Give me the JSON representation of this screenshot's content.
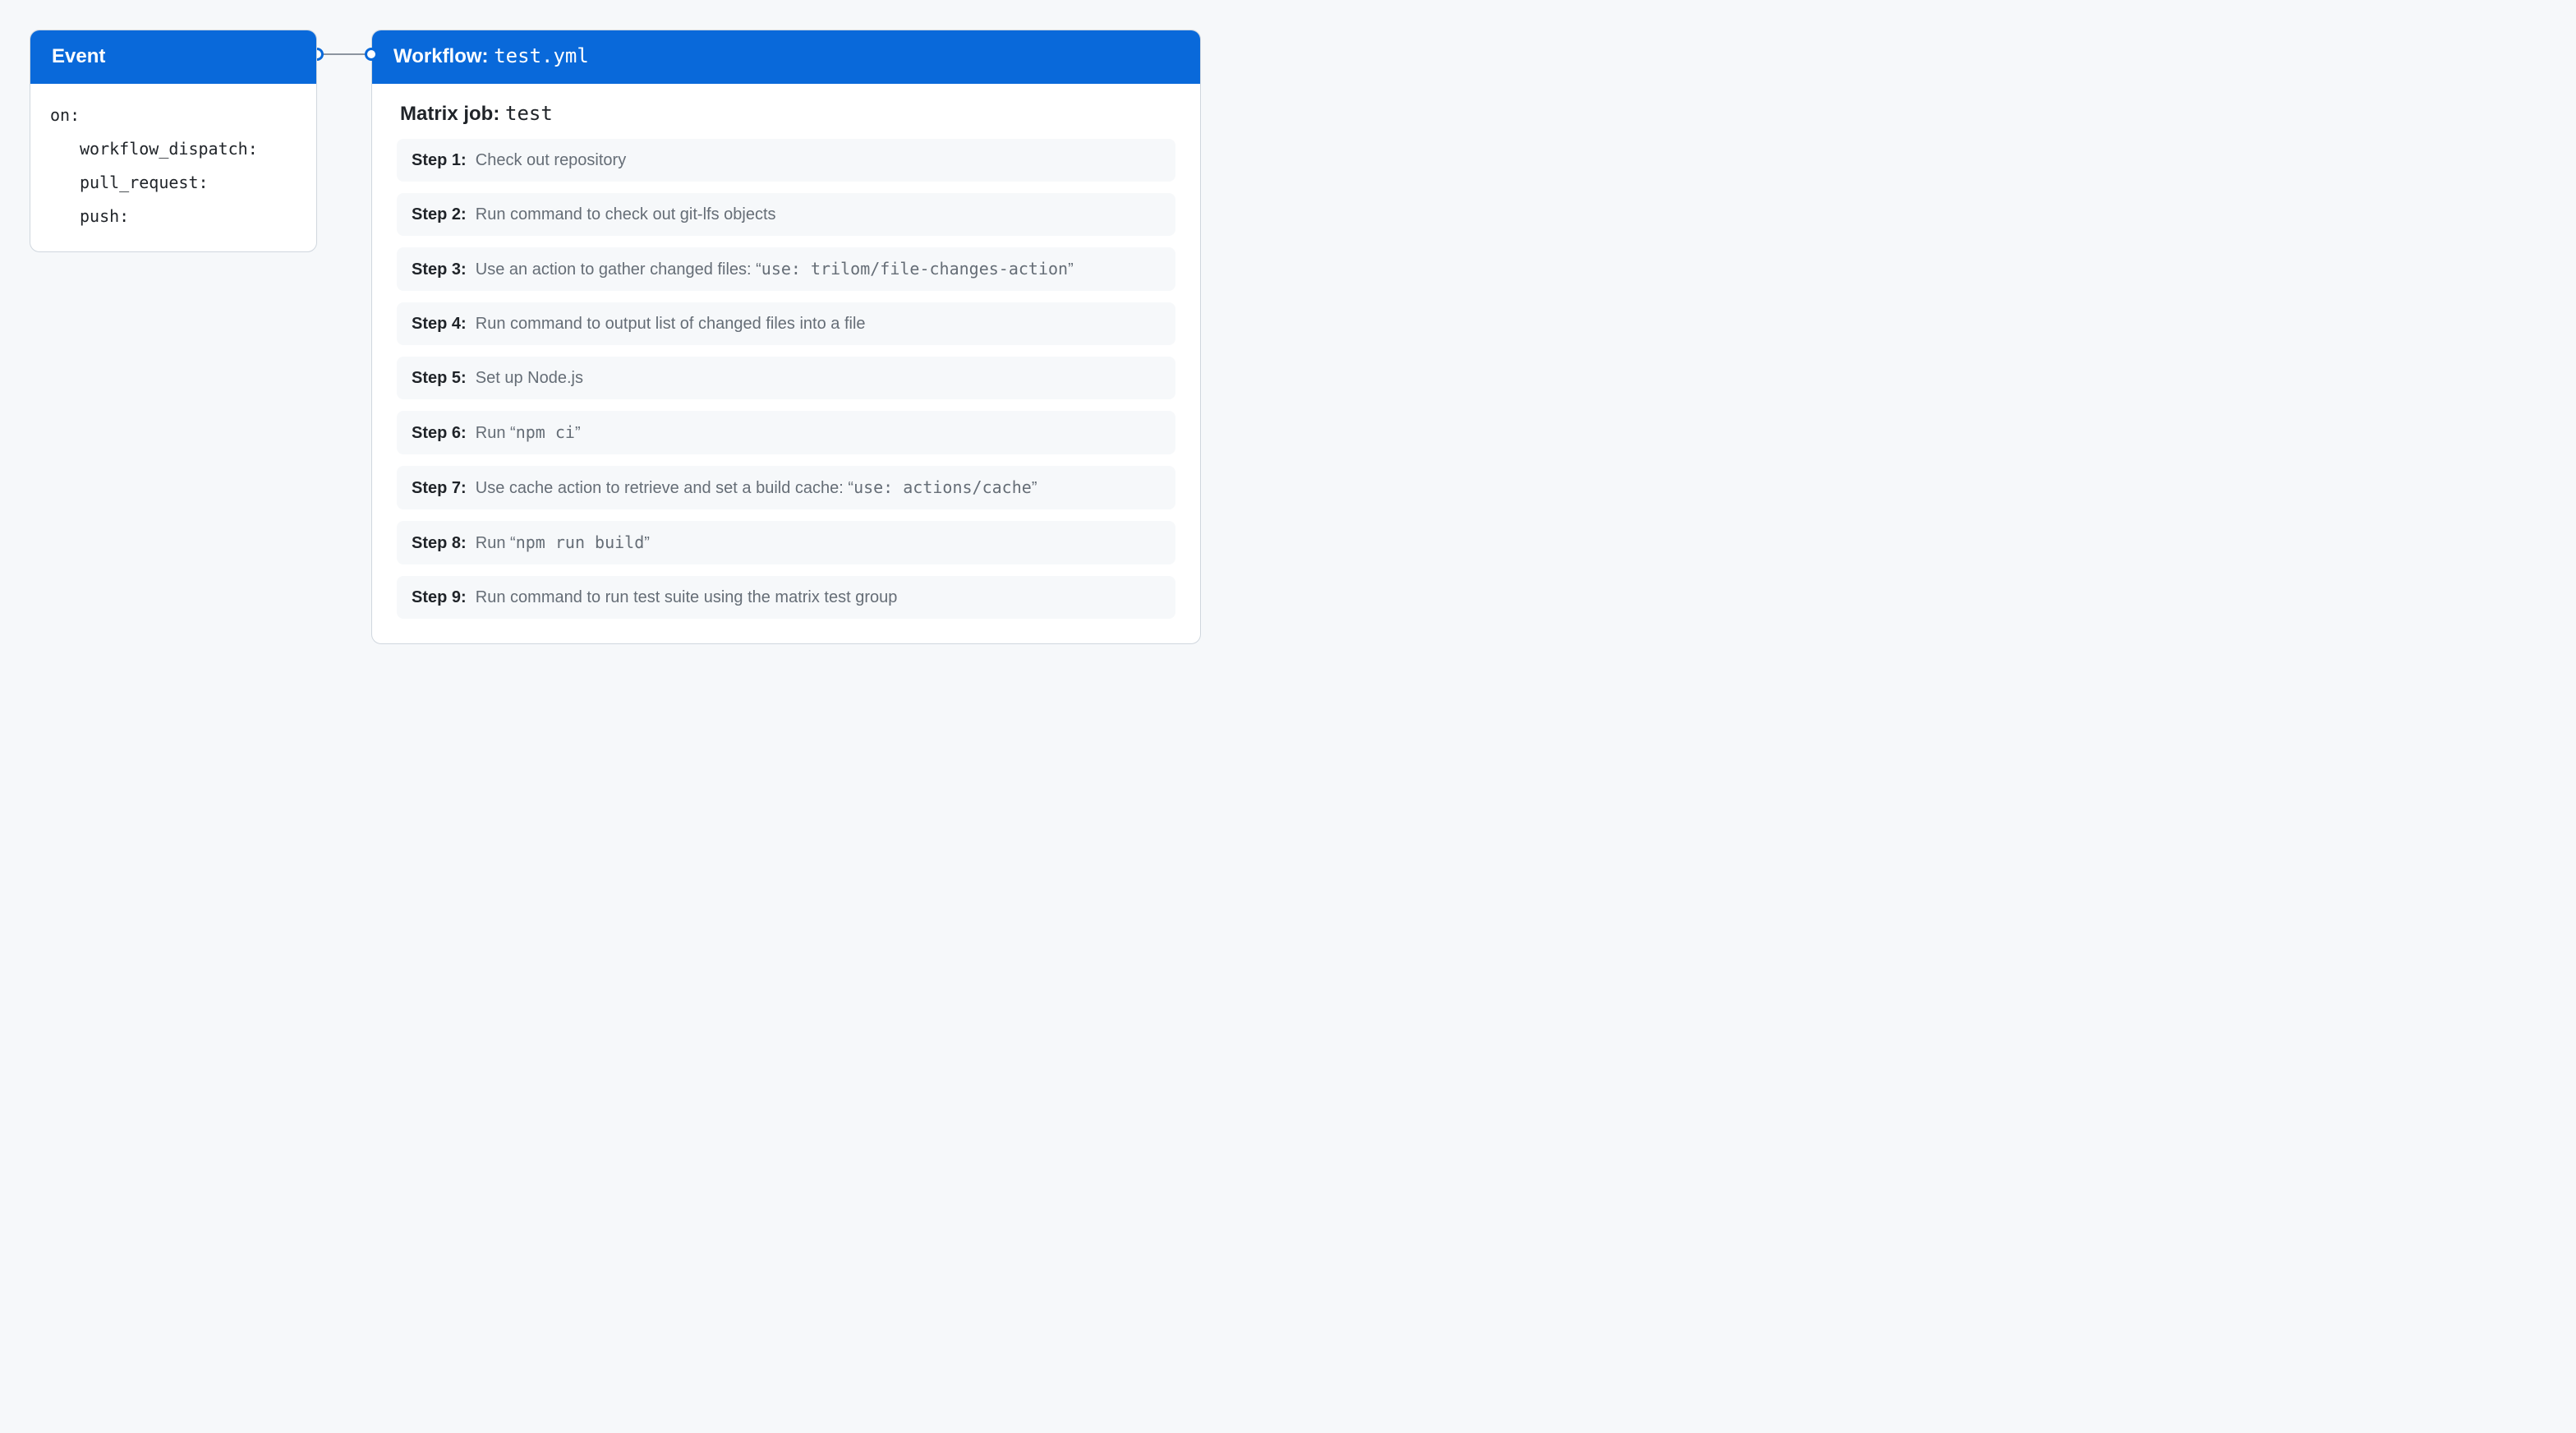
{
  "event": {
    "header": "Event",
    "on_label": "on:",
    "triggers": [
      "workflow_dispatch:",
      "pull_request:",
      "push:"
    ]
  },
  "workflow": {
    "header_prefix": "Workflow: ",
    "header_file": "test.yml",
    "matrix_prefix": "Matrix job: ",
    "matrix_name": "test",
    "steps": [
      {
        "label": "Step 1:",
        "parts": [
          {
            "t": "Check out repository"
          }
        ]
      },
      {
        "label": "Step 2:",
        "parts": [
          {
            "t": "Run command to check out git-lfs objects"
          }
        ]
      },
      {
        "label": "Step 3:",
        "parts": [
          {
            "t": "Use an action to gather changed files: “"
          },
          {
            "t": "use: trilom/file-changes-action",
            "mono": true
          },
          {
            "t": "”"
          }
        ]
      },
      {
        "label": "Step 4:",
        "parts": [
          {
            "t": "Run command to output list of changed files into a file"
          }
        ]
      },
      {
        "label": "Step 5:",
        "parts": [
          {
            "t": "Set up Node.js"
          }
        ]
      },
      {
        "label": "Step 6:",
        "parts": [
          {
            "t": "Run “"
          },
          {
            "t": "npm ci",
            "mono": true
          },
          {
            "t": "”"
          }
        ]
      },
      {
        "label": "Step 7:",
        "parts": [
          {
            "t": "Use cache action to retrieve and set a build cache: “"
          },
          {
            "t": "use: actions/cache",
            "mono": true
          },
          {
            "t": "”"
          }
        ]
      },
      {
        "label": "Step 8:",
        "parts": [
          {
            "t": "Run “"
          },
          {
            "t": "npm run build",
            "mono": true
          },
          {
            "t": "”"
          }
        ]
      },
      {
        "label": "Step 9:",
        "parts": [
          {
            "t": "Run command to run test suite using the matrix test group"
          }
        ]
      }
    ]
  }
}
